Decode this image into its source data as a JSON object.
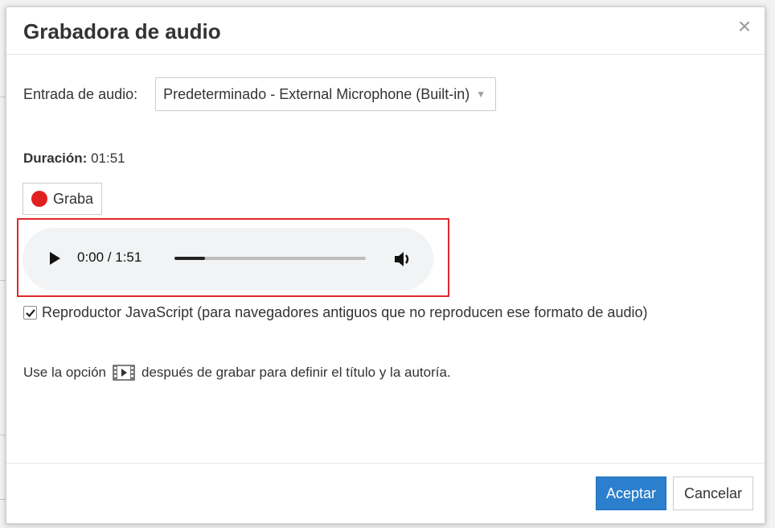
{
  "dialog": {
    "title": "Grabadora de audio",
    "close_glyph": "×"
  },
  "audio_input": {
    "label": "Entrada de audio:",
    "selected": "Predeterminado - External Microphone (Built-in)"
  },
  "duration": {
    "label": "Duración:",
    "value": "01:51"
  },
  "record_button": {
    "label": "Graba"
  },
  "player": {
    "time": "0:00 / 1:51",
    "progress_fraction": 0.16
  },
  "javascript_player": {
    "checked": true,
    "label": "Reproductor JavaScript (para navegadores antiguos que no reproducen ese formato de audio)"
  },
  "hint": {
    "before": "Use la opción",
    "after": "después de grabar para definir el título y la autoría.",
    "icon": "media-properties-icon"
  },
  "footer": {
    "accept_label": "Aceptar",
    "cancel_label": "Cancelar"
  },
  "colors": {
    "accent": "#2b7fcd",
    "record": "#e02020",
    "highlight": "#e0282b"
  }
}
